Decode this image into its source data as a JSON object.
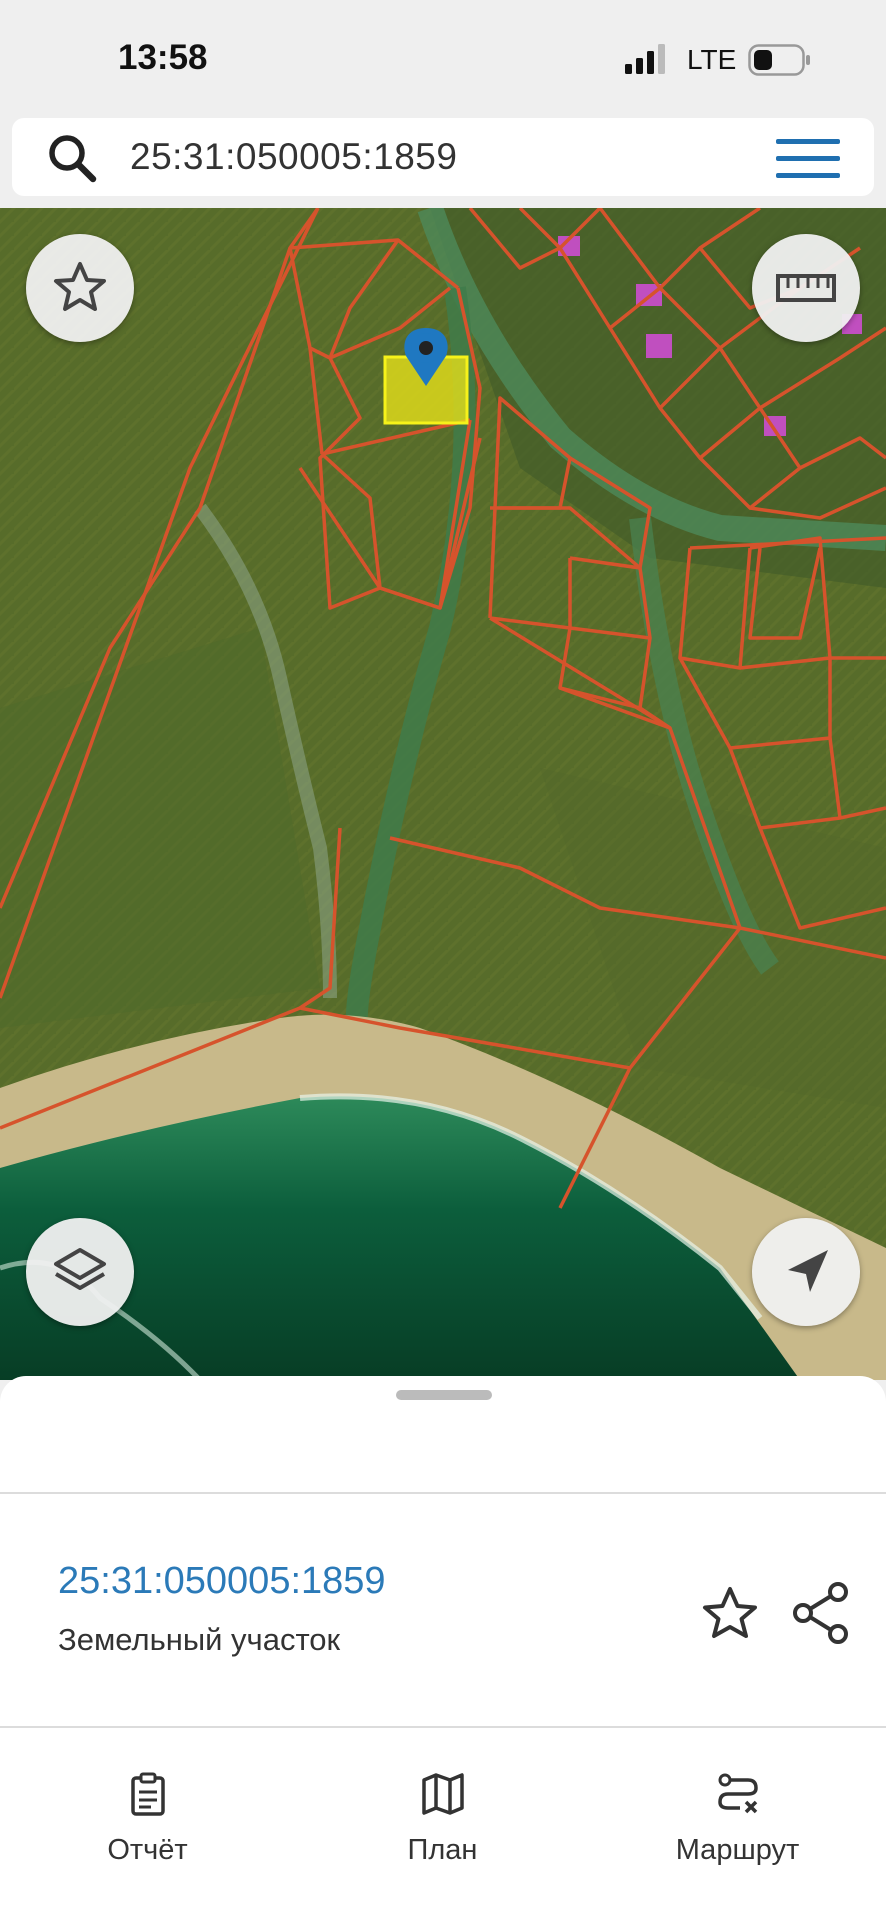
{
  "status_bar": {
    "time": "13:58",
    "network": "LTE",
    "signal_icon": "cellular-signal-icon",
    "battery_icon": "battery-icon"
  },
  "search": {
    "value": "25:31:050005:1859",
    "icon": "search-icon",
    "menu_icon": "hamburger-menu-icon"
  },
  "map": {
    "type": "satellite-cadastral",
    "buttons": [
      {
        "name": "favorite",
        "icon": "star-icon"
      },
      {
        "name": "ruler",
        "icon": "ruler-icon"
      },
      {
        "name": "layers",
        "icon": "layers-icon"
      },
      {
        "name": "locate",
        "icon": "navigation-arrow-icon"
      }
    ],
    "colors": {
      "parcel_border": "#d6532c",
      "selected_parcel": "#e8e21a",
      "marker": "#1f78c1"
    }
  },
  "sheet": {
    "parcel_id": "25:31:050005:1859",
    "parcel_type": "Земельный участок",
    "favorite_icon": "star-icon",
    "share_icon": "share-icon"
  },
  "tabs": [
    {
      "label": "Отчёт",
      "icon": "clipboard-icon"
    },
    {
      "label": "План",
      "icon": "map-icon"
    },
    {
      "label": "Маршрут",
      "icon": "route-icon"
    }
  ]
}
